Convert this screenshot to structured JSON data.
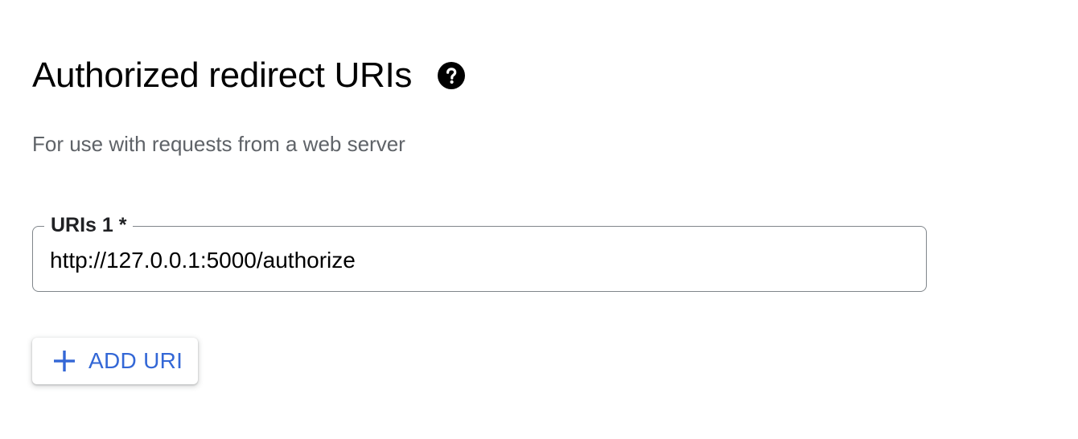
{
  "section": {
    "title": "Authorized redirect URIs",
    "help_icon": "help-circle-icon",
    "subtitle": "For use with requests from a web server"
  },
  "uri_field": {
    "label": "URIs 1 *",
    "value": "http://127.0.0.1:5000/authorize"
  },
  "add_button": {
    "icon": "plus-icon",
    "label": "ADD URI"
  },
  "colors": {
    "accent": "#3367d6",
    "subtitle_text": "#5f6368",
    "field_border": "#80868b"
  }
}
